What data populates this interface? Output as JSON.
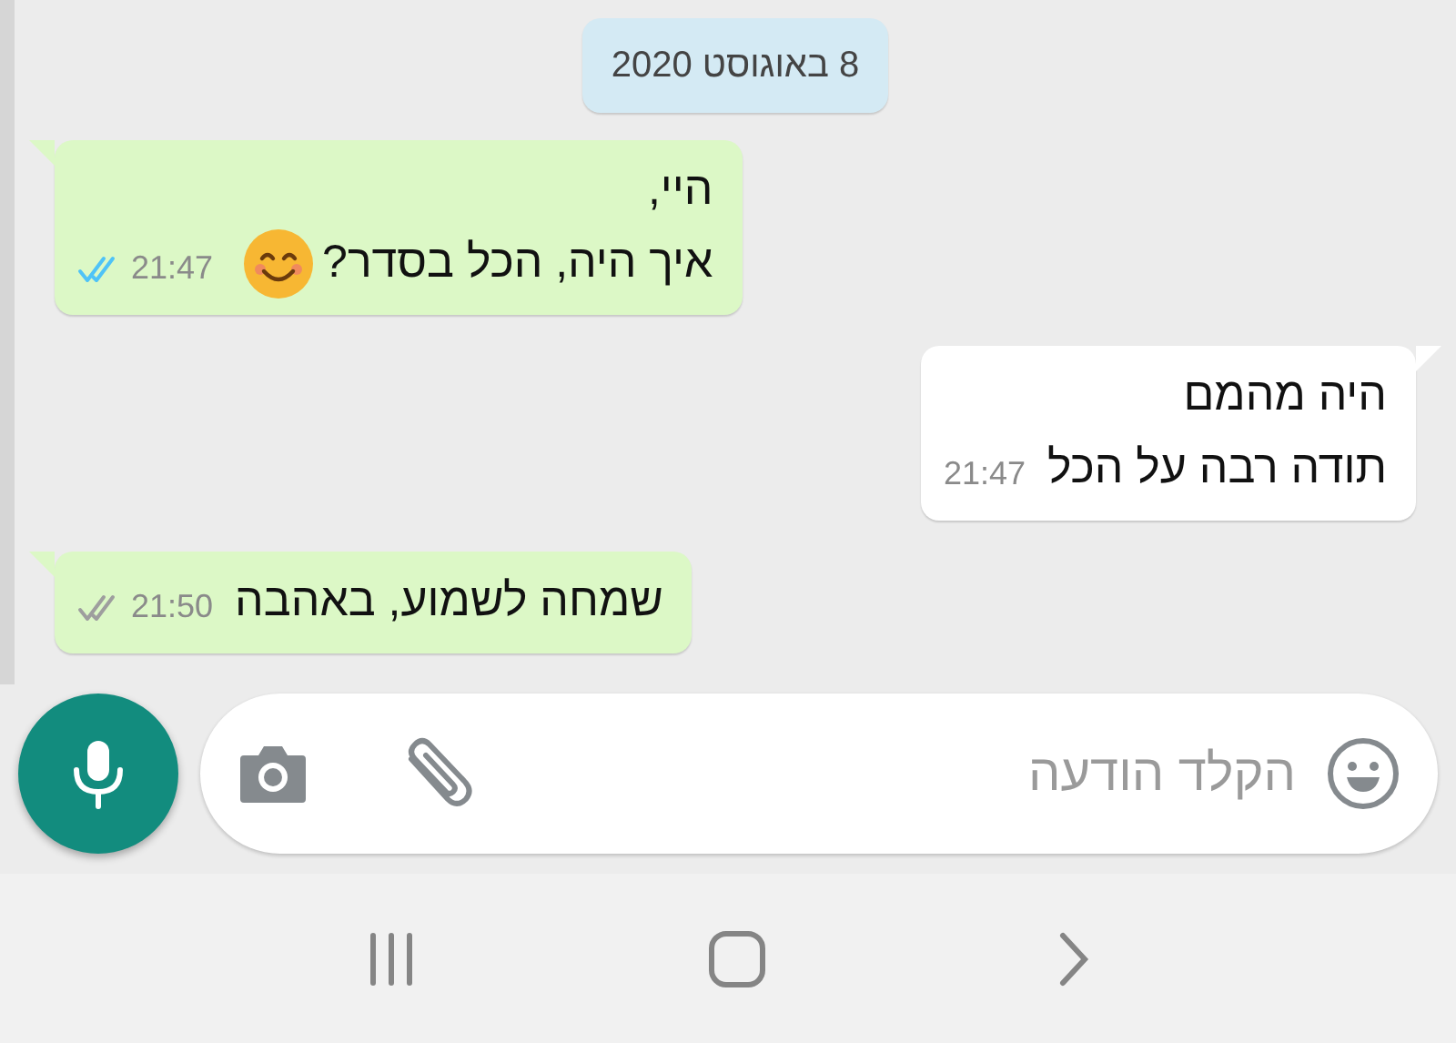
{
  "date_pill": "8 באוגוסט 2020",
  "messages": [
    {
      "kind": "sent",
      "lines": [
        {
          "text": "היי,",
          "emoji": false
        },
        {
          "text": "איך היה, הכל בסדר?",
          "emoji": true
        }
      ],
      "time": "21:47",
      "read": true
    },
    {
      "kind": "received",
      "lines": [
        {
          "text": "היה מהמם",
          "emoji": false
        },
        {
          "text": "תודה רבה על הכל",
          "emoji": false
        }
      ],
      "time": "21:47"
    },
    {
      "kind": "sent",
      "lines": [
        {
          "text": "שמחה לשמוע, באהבה",
          "emoji": false
        }
      ],
      "time": "21:50",
      "read": false
    }
  ],
  "composer": {
    "placeholder": "הקלד הודעה"
  }
}
